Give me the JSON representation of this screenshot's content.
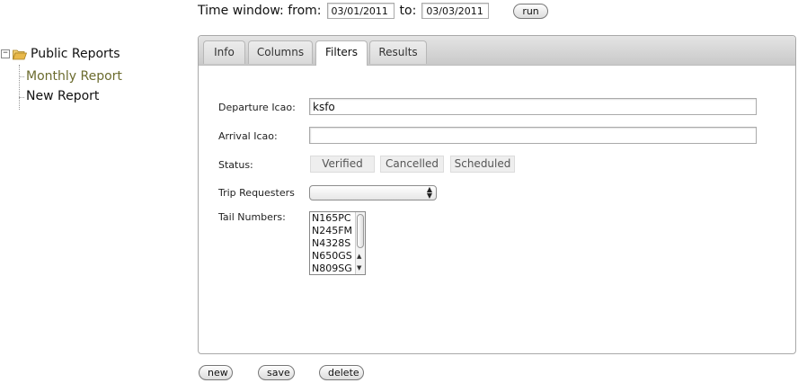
{
  "toolbar": {
    "time_window_label": "Time window: from:",
    "from_value": "03/01/2011",
    "to_label": "to:",
    "to_value": "03/03/2011",
    "run_label": "run"
  },
  "tree": {
    "toggle": "−",
    "root_label": "Public Reports",
    "children": [
      {
        "label": "Monthly Report",
        "selected": true
      },
      {
        "label": "New Report",
        "selected": false
      }
    ]
  },
  "tabs": [
    {
      "label": "Info",
      "active": false
    },
    {
      "label": "Columns",
      "active": false
    },
    {
      "label": "Filters",
      "active": true
    },
    {
      "label": "Results",
      "active": false
    }
  ],
  "filters": {
    "departure_label": "Departure Icao:",
    "departure_value": "ksfo",
    "arrival_label": "Arrival Icao:",
    "arrival_value": "",
    "status_label": "Status:",
    "status_options": [
      "Verified",
      "Cancelled",
      "Scheduled"
    ],
    "trip_requesters_label": "Trip Requesters",
    "trip_requesters_value": "",
    "tail_numbers_label": "Tail Numbers:",
    "tail_numbers": [
      "N165PC",
      "N245FM",
      "N4328S",
      "N650GS",
      "N809SG"
    ]
  },
  "actions": {
    "new_label": "new",
    "save_label": "save",
    "delete_label": "delete"
  },
  "colors": {
    "selected_tree_item": "#6b6b2e",
    "folder": "#e8b84a"
  },
  "icons": {
    "folder": "folder-open-icon",
    "select_arrows": "up-down-arrows-icon"
  }
}
